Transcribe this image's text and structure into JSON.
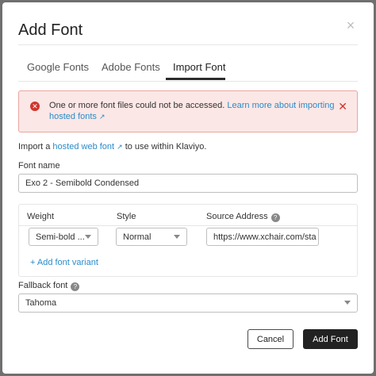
{
  "dialog": {
    "title": "Add Font",
    "close_symbol": "×"
  },
  "tabs": [
    {
      "label": "Google Fonts",
      "active": false
    },
    {
      "label": "Adobe Fonts",
      "active": false
    },
    {
      "label": "Import Font",
      "active": true
    }
  ],
  "alert": {
    "message": "One or more font files could not be accessed.",
    "link_text_1": "Learn more about importing",
    "link_text_2": "hosted fonts",
    "icon": "error-circle-icon",
    "color": "#d0352c"
  },
  "intro": {
    "prefix": "Import a",
    "link": "hosted web font",
    "suffix": "to use within Klaviyo."
  },
  "font_name": {
    "label": "Font name",
    "value": "Exo 2 - Semibold Condensed"
  },
  "variants": {
    "headers": {
      "weight": "Weight",
      "style": "Style",
      "source": "Source Address"
    },
    "rows": [
      {
        "weight": "Semi-bold ...",
        "style": "Normal",
        "source": "https://www.xchair.com/sta"
      }
    ],
    "add_label": "+ Add font variant"
  },
  "fallback": {
    "label": "Fallback font",
    "value": "Tahoma"
  },
  "buttons": {
    "cancel": "Cancel",
    "add": "Add Font"
  },
  "colors": {
    "link": "#2a8bc9",
    "primary_button": "#222222",
    "alert_bg": "#fbe7e6"
  }
}
